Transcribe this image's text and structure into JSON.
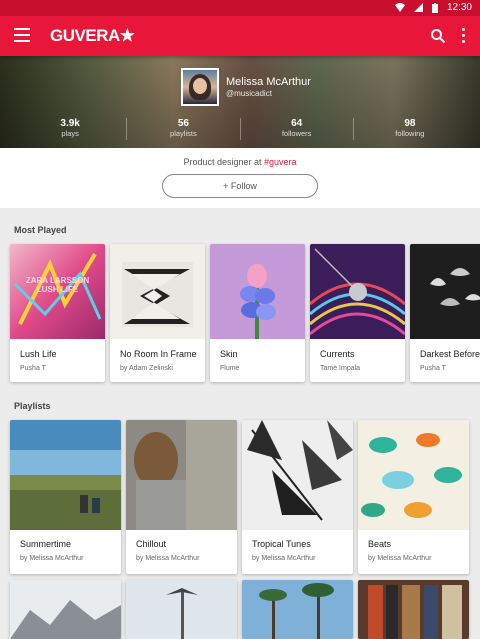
{
  "status_bar": {
    "time": "12:30"
  },
  "app_bar": {
    "logo": "GUVERA★"
  },
  "profile": {
    "name": "Melissa McArthur",
    "handle": "@musicadict",
    "stats": [
      {
        "value": "3.9k",
        "label": "plays"
      },
      {
        "value": "56",
        "label": "playlists"
      },
      {
        "value": "64",
        "label": "followers"
      },
      {
        "value": "98",
        "label": "following"
      }
    ],
    "bio_prefix": "Product designer at ",
    "bio_tag": "#guvera",
    "follow_label": "+ Follow"
  },
  "most_played": {
    "title": "Most Played",
    "items": [
      {
        "title": "Lush Life",
        "subtitle": "Pusha T",
        "art_text": "ZARA LARSSON LUSH LIFE"
      },
      {
        "title": "No Room In Frame",
        "subtitle": "by Adam Zelinski"
      },
      {
        "title": "Skin",
        "subtitle": "Flume"
      },
      {
        "title": "Currents",
        "subtitle": "Tame Impala"
      },
      {
        "title": "Darkest Before",
        "subtitle": "Pusha T"
      }
    ]
  },
  "playlists": {
    "title": "Playlists",
    "items": [
      {
        "title": "Summertime",
        "subtitle": "by Melissa McArthur"
      },
      {
        "title": "Chillout",
        "subtitle": "by Melissa McArthur"
      },
      {
        "title": "Tropical Tunes",
        "subtitle": "by Melissa McArthur"
      },
      {
        "title": "Beats",
        "subtitle": "by Melissa McArthur"
      }
    ]
  }
}
